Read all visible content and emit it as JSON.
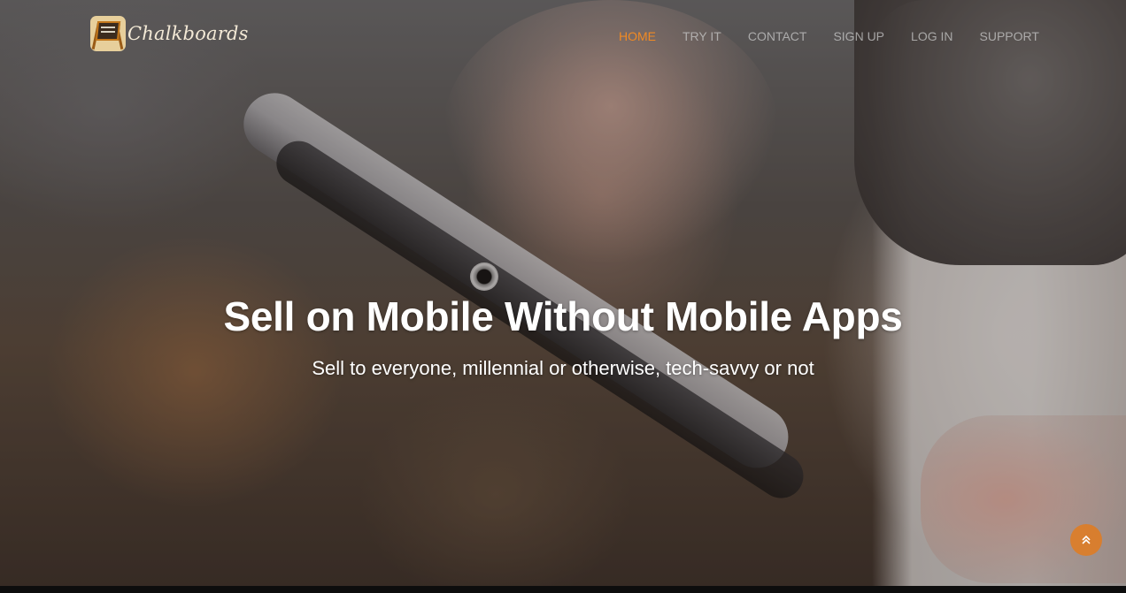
{
  "brand": {
    "name": "Chalkboards"
  },
  "nav": {
    "items": [
      {
        "label": "HOME",
        "active": true
      },
      {
        "label": "TRY IT",
        "active": false
      },
      {
        "label": "CONTACT",
        "active": false
      },
      {
        "label": "SIGN UP",
        "active": false
      },
      {
        "label": "LOG IN",
        "active": false
      },
      {
        "label": "SUPPORT",
        "active": false
      }
    ]
  },
  "hero": {
    "title": "Sell on Mobile Without Mobile Apps",
    "subtitle": "Sell to everyone, millennial or otherwise, tech-savvy or not"
  },
  "scroll_top": {
    "icon": "double-chevron-up-icon"
  },
  "colors": {
    "accent": "#f08a24",
    "scroll_top_bg": "#e27b1e",
    "nav_text": "#c8c8c8",
    "headline": "#ffffff"
  }
}
